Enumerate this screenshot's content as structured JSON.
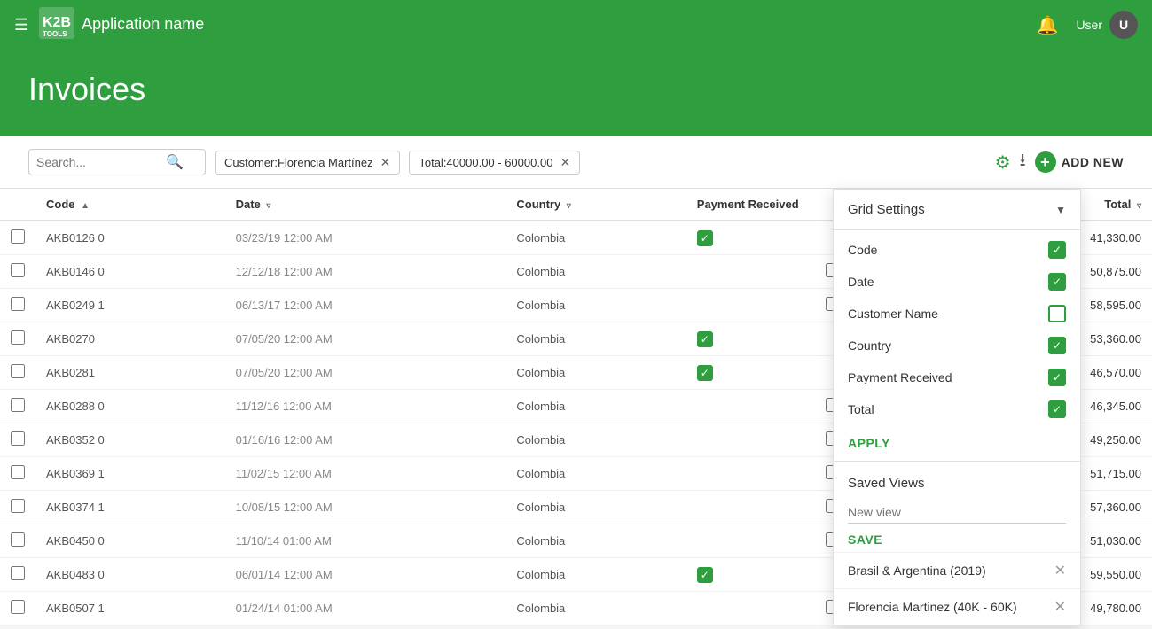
{
  "nav": {
    "app_name": "Application name",
    "user_name": "User",
    "user_initial": "U"
  },
  "page": {
    "title": "Invoices"
  },
  "toolbar": {
    "search_placeholder": "Search...",
    "filter_customer_label": "Customer:Florencia Martínez",
    "filter_total_label": "Total:40000.00 - 60000.00",
    "add_new_label": "ADD NEW"
  },
  "table": {
    "columns": [
      "Code",
      "Date",
      "Country",
      "Payment Received",
      "Total"
    ],
    "rows": [
      {
        "code": "AKB0126 0",
        "date": "03/23/19 12:00 AM",
        "country": "Colombia",
        "payment_received": true,
        "total": "41,330.00"
      },
      {
        "code": "AKB0146 0",
        "date": "12/12/18 12:00 AM",
        "country": "Colombia",
        "payment_received": false,
        "total": "50,875.00"
      },
      {
        "code": "AKB0249 1",
        "date": "06/13/17 12:00 AM",
        "country": "Colombia",
        "payment_received": false,
        "total": "58,595.00"
      },
      {
        "code": "AKB0270",
        "date": "07/05/20 12:00 AM",
        "country": "Colombia",
        "payment_received": true,
        "total": "53,360.00"
      },
      {
        "code": "AKB0281",
        "date": "07/05/20 12:00 AM",
        "country": "Colombia",
        "payment_received": true,
        "total": "46,570.00"
      },
      {
        "code": "AKB0288 0",
        "date": "11/12/16 12:00 AM",
        "country": "Colombia",
        "payment_received": false,
        "total": "46,345.00"
      },
      {
        "code": "AKB0352 0",
        "date": "01/16/16 12:00 AM",
        "country": "Colombia",
        "payment_received": false,
        "total": "49,250.00"
      },
      {
        "code": "AKB0369 1",
        "date": "11/02/15 12:00 AM",
        "country": "Colombia",
        "payment_received": false,
        "total": "51,715.00"
      },
      {
        "code": "AKB0374 1",
        "date": "10/08/15 12:00 AM",
        "country": "Colombia",
        "payment_received": false,
        "total": "57,360.00"
      },
      {
        "code": "AKB0450 0",
        "date": "11/10/14 01:00 AM",
        "country": "Colombia",
        "payment_received": false,
        "total": "51,030.00"
      },
      {
        "code": "AKB0483 0",
        "date": "06/01/14 12:00 AM",
        "country": "Colombia",
        "payment_received": true,
        "total": "59,550.00"
      },
      {
        "code": "AKB0507 1",
        "date": "01/24/14 01:00 AM",
        "country": "Colombia",
        "payment_received": false,
        "total": "49,780.00"
      }
    ]
  },
  "grid_settings": {
    "title": "Grid Settings",
    "fields": [
      {
        "label": "Code",
        "checked": true
      },
      {
        "label": "Date",
        "checked": true
      },
      {
        "label": "Customer Name",
        "checked": false
      },
      {
        "label": "Country",
        "checked": true
      },
      {
        "label": "Payment Received",
        "checked": true
      },
      {
        "label": "Total",
        "checked": true
      }
    ],
    "apply_label": "APPLY",
    "saved_views_label": "Saved Views",
    "new_view_placeholder": "New view",
    "save_label": "SAVE",
    "saved_views": [
      {
        "name": "Brasil & Argentina (2019)"
      },
      {
        "name": "Florencia Martinez (40K - 60K)"
      }
    ]
  }
}
